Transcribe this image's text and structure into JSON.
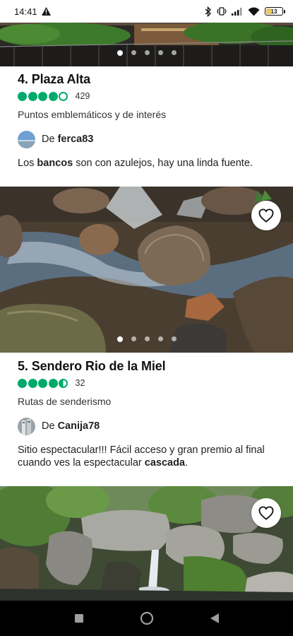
{
  "status_bar": {
    "time": "14:41",
    "battery": "13"
  },
  "listings": [
    {
      "title": "4. Plaza Alta",
      "rating": 4,
      "review_count": "429",
      "category": "Puntos emblemáticos y de interés",
      "author_prefix": "De",
      "author": "ferca83",
      "review_parts": [
        "Los ",
        "bancos",
        " son con azulejos, hay una linda fuente."
      ]
    },
    {
      "title": "5. Sendero Rio de la Miel",
      "rating": 4.5,
      "review_count": "32",
      "category": "Rutas de senderismo",
      "author_prefix": "De",
      "author": "Canija78",
      "review_parts": [
        "Sitio espectacular!!! Fácil acceso y gran premio al final cuando ves la espectacular ",
        "cascada",
        "."
      ]
    }
  ],
  "carousel": {
    "dot_count": 5,
    "active_index": 0
  },
  "icons": {
    "alert": "warning-icon",
    "favorite": "heart-outline-icon",
    "nav_recents": "square-icon",
    "nav_home": "circle-icon",
    "nav_back": "triangle-back-icon"
  },
  "colors": {
    "rating_green": "#00aa6c"
  }
}
